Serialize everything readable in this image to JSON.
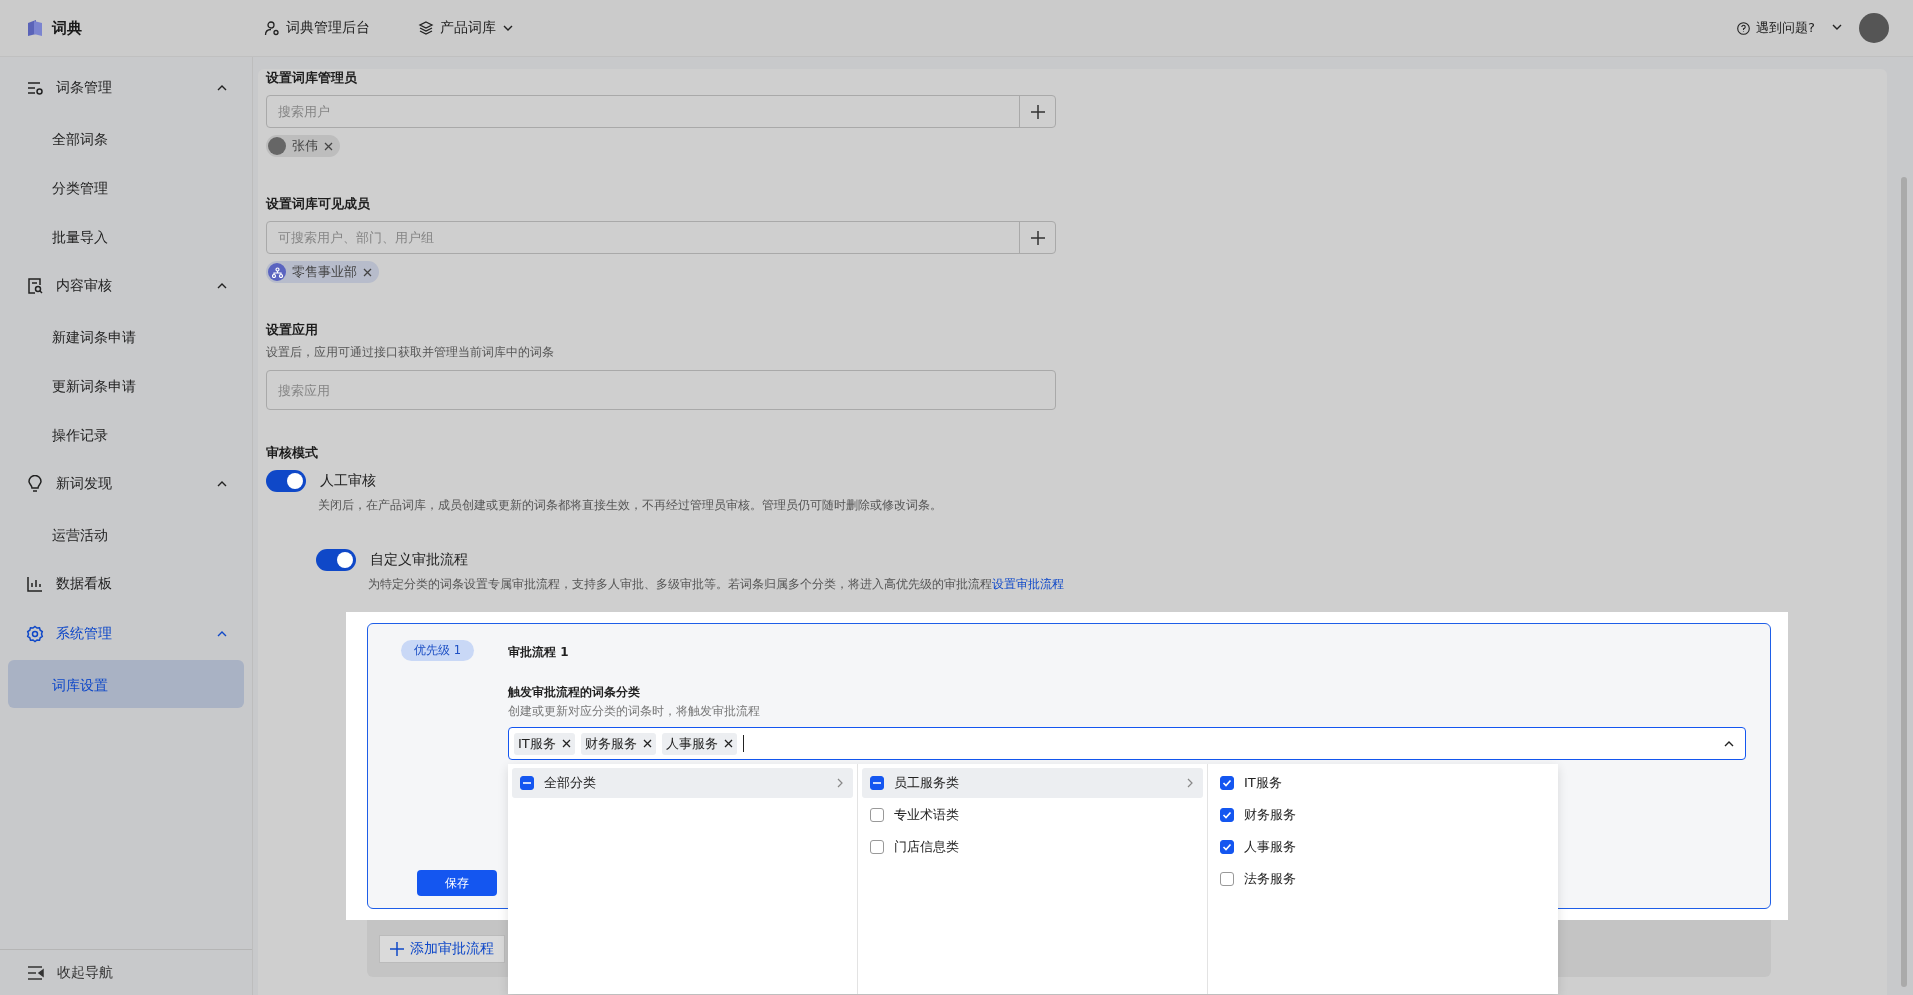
{
  "topbar": {
    "logo_text": "词典",
    "nav": [
      {
        "label": "词典管理后台",
        "kind": "link"
      },
      {
        "label": "产品词库",
        "kind": "dropdown"
      }
    ],
    "help": "遇到问题?"
  },
  "sidebar": {
    "groups": [
      {
        "label": "词条管理",
        "kind": "terms",
        "selected": false,
        "expanded": true,
        "children": [
          {
            "label": "全部词条",
            "selected": false
          },
          {
            "label": "分类管理",
            "selected": false
          },
          {
            "label": "批量导入",
            "selected": false
          }
        ]
      },
      {
        "label": "内容审核",
        "kind": "review",
        "selected": false,
        "expanded": true,
        "children": [
          {
            "label": "新建词条申请",
            "selected": false
          },
          {
            "label": "更新词条申请",
            "selected": false
          },
          {
            "label": "操作记录",
            "selected": false
          }
        ]
      },
      {
        "label": "新词发现",
        "kind": "bulb",
        "selected": false,
        "expanded": true,
        "children": [
          {
            "label": "运营活动",
            "selected": false
          }
        ]
      },
      {
        "label": "数据看板",
        "kind": "chart",
        "selected": false
      },
      {
        "label": "系统管理",
        "kind": "gear",
        "selected": true,
        "expanded": true,
        "children": [
          {
            "label": "词库设置",
            "selected": true
          }
        ]
      }
    ],
    "collapse": "收起导航"
  },
  "form": {
    "admins": {
      "label": "设置词库管理员",
      "placeholder": "搜索用户",
      "tags": [
        {
          "label": "张伟",
          "kind": "user"
        }
      ]
    },
    "members": {
      "label": "设置词库可见成员",
      "placeholder": "可搜索用户、部门、用户组",
      "tags": [
        {
          "label": "零售事业部",
          "kind": "department"
        }
      ]
    },
    "apps": {
      "label": "设置应用",
      "description": "设置后，应用可通过接口获取并管理当前词库中的词条",
      "placeholder": "搜索应用"
    },
    "review": {
      "label": "审核模式",
      "manual": {
        "label": "人工审核",
        "on": true,
        "description": "关闭后，在产品词库，成员创建或更新的词条都将直接生效，不再经过管理员审核。管理员仍可随时删除或修改词条。"
      },
      "custom": {
        "label": "自定义审批流程",
        "on": true,
        "description": "为特定分类的词条设置专属审批流程，支持多人审批、多级审批等。若词条归属多个分类，将进入高优先级的审批流程",
        "link": "设置审批流程"
      }
    }
  },
  "flow": {
    "priority": "优先级 1",
    "title": "审批流程 1",
    "field_label": "触发审批流程的词条分类",
    "field_hint": "创建或更新对应分类的词条时，将触发审批流程",
    "tags": [
      "IT服务",
      "财务服务",
      "人事服务"
    ],
    "expanded": true,
    "save": "保存",
    "columns": [
      [
        {
          "label": "全部分类",
          "checked": false,
          "indeterminate": true,
          "selected": true,
          "has_children": true
        }
      ],
      [
        {
          "label": "员工服务类",
          "checked": false,
          "indeterminate": true,
          "selected": true,
          "has_children": true
        },
        {
          "label": "专业术语类",
          "checked": false,
          "indeterminate": false,
          "selected": false,
          "has_children": false
        },
        {
          "label": "门店信息类",
          "checked": false,
          "indeterminate": false,
          "selected": false,
          "has_children": false
        }
      ],
      [
        {
          "label": "IT服务",
          "checked": true,
          "indeterminate": false,
          "selected": false,
          "has_children": false
        },
        {
          "label": "财务服务",
          "checked": true,
          "indeterminate": false,
          "selected": false,
          "has_children": false
        },
        {
          "label": "人事服务",
          "checked": true,
          "indeterminate": false,
          "selected": false,
          "has_children": false
        },
        {
          "label": "法务服务",
          "checked": false,
          "indeterminate": false,
          "selected": false,
          "has_children": false
        }
      ]
    ]
  },
  "add_flow": "添加审批流程"
}
